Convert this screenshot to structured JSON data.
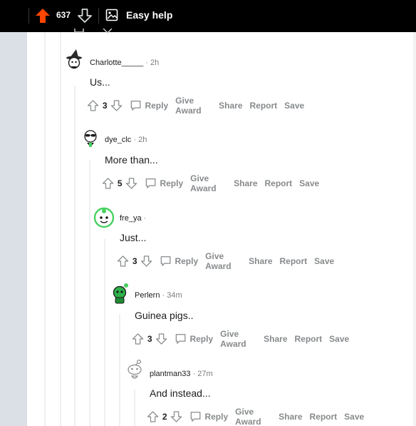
{
  "topbar": {
    "score": "637",
    "title": "Easy help"
  },
  "actions_labels": {
    "reply": "Reply",
    "give_award": "Give Award",
    "share": "Share",
    "report": "Report",
    "save": "Save"
  },
  "comments": [
    {
      "author": "Charlotte_____",
      "time": "· 2h",
      "text": "Us...",
      "votes": "3"
    },
    {
      "author": "dye_clc",
      "time": "· 2h",
      "text": "More than...",
      "votes": "5"
    },
    {
      "author": "fre_ya",
      "time": "·",
      "text": "Just...",
      "votes": "3"
    },
    {
      "author": "Perlern",
      "time": "· 34m",
      "text": "Guinea pigs..",
      "votes": "3"
    },
    {
      "author": "plantman33",
      "time": "· 27m",
      "text": "And instead...",
      "votes": "2"
    }
  ],
  "colors": {
    "upvote_active": "#ff4500",
    "muted": "#878a8c",
    "thread_line": "#edeff1",
    "gutter": "#dae0e6"
  }
}
